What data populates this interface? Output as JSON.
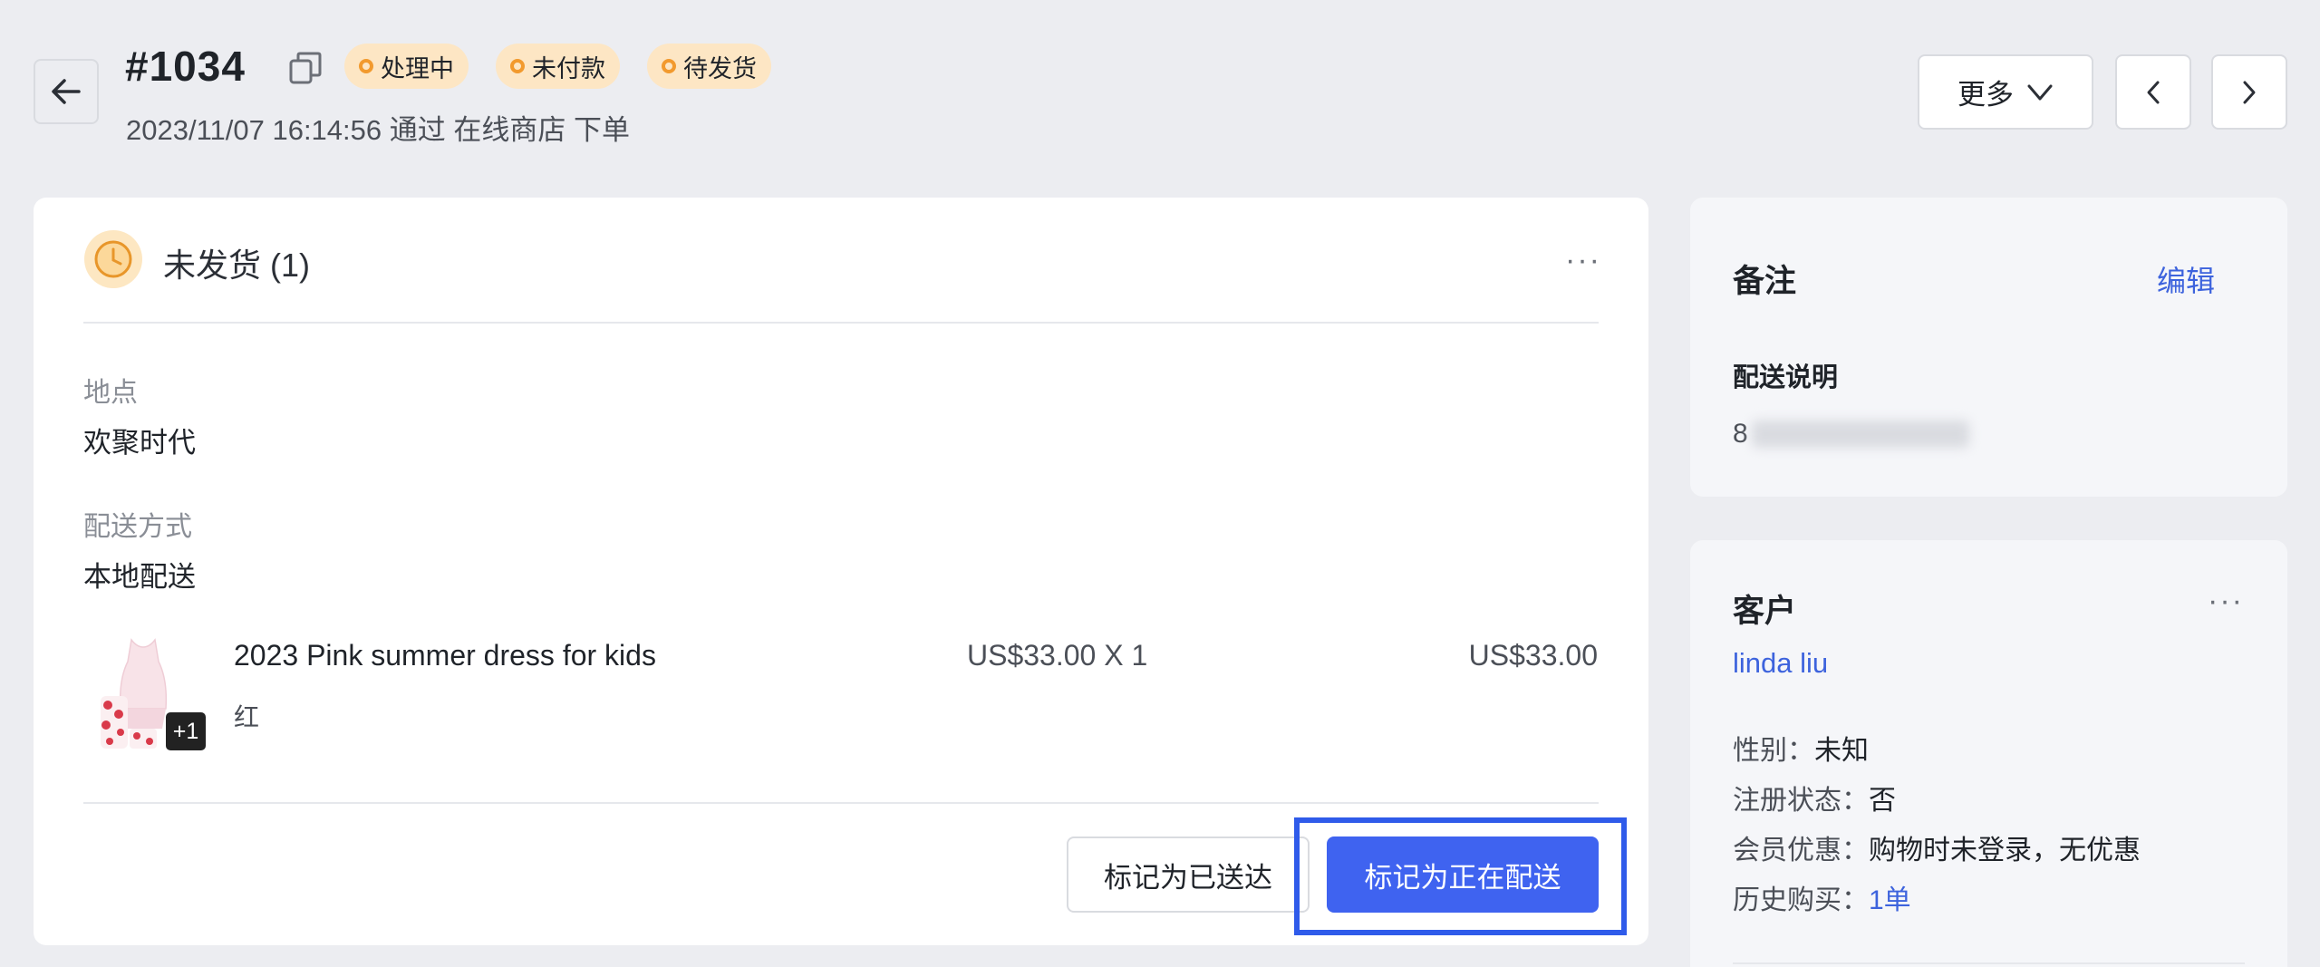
{
  "header": {
    "order_number": "#1034",
    "badges": [
      "处理中",
      "未付款",
      "待发货"
    ],
    "meta": "2023/11/07 16:14:56 通过 在线商店 下单",
    "more_label": "更多"
  },
  "fulfillment": {
    "title": "未发货 (1)",
    "location_label": "地点",
    "location_value": "欢聚时代",
    "shipping_label": "配送方式",
    "shipping_value": "本地配送",
    "item": {
      "name": "2023 Pink summer dress for kids",
      "variant": "红",
      "extra_images": "+1",
      "unit_price": "US$33.00 X 1",
      "total": "US$33.00"
    },
    "mark_delivered_label": "标记为已送达",
    "mark_shipping_label": "标记为正在配送"
  },
  "notes": {
    "title": "备注",
    "edit_label": "编辑",
    "delivery_note_label": "配送说明",
    "delivery_note_value_visible": "8"
  },
  "customer": {
    "title": "客户",
    "name": "linda liu",
    "gender_label": "性别：",
    "gender_value": "未知",
    "registered_label": "注册状态：",
    "registered_value": "否",
    "member_label": "会员优惠：",
    "member_value": "购物时未登录，无优惠",
    "history_label": "历史购买：",
    "history_value": "1单"
  },
  "colors": {
    "accent": "#3f63f0",
    "link": "#3d63dd",
    "badge_bg": "#fde6c4",
    "badge_dot": "#f29a2e",
    "highlight": "#2f5bea"
  }
}
